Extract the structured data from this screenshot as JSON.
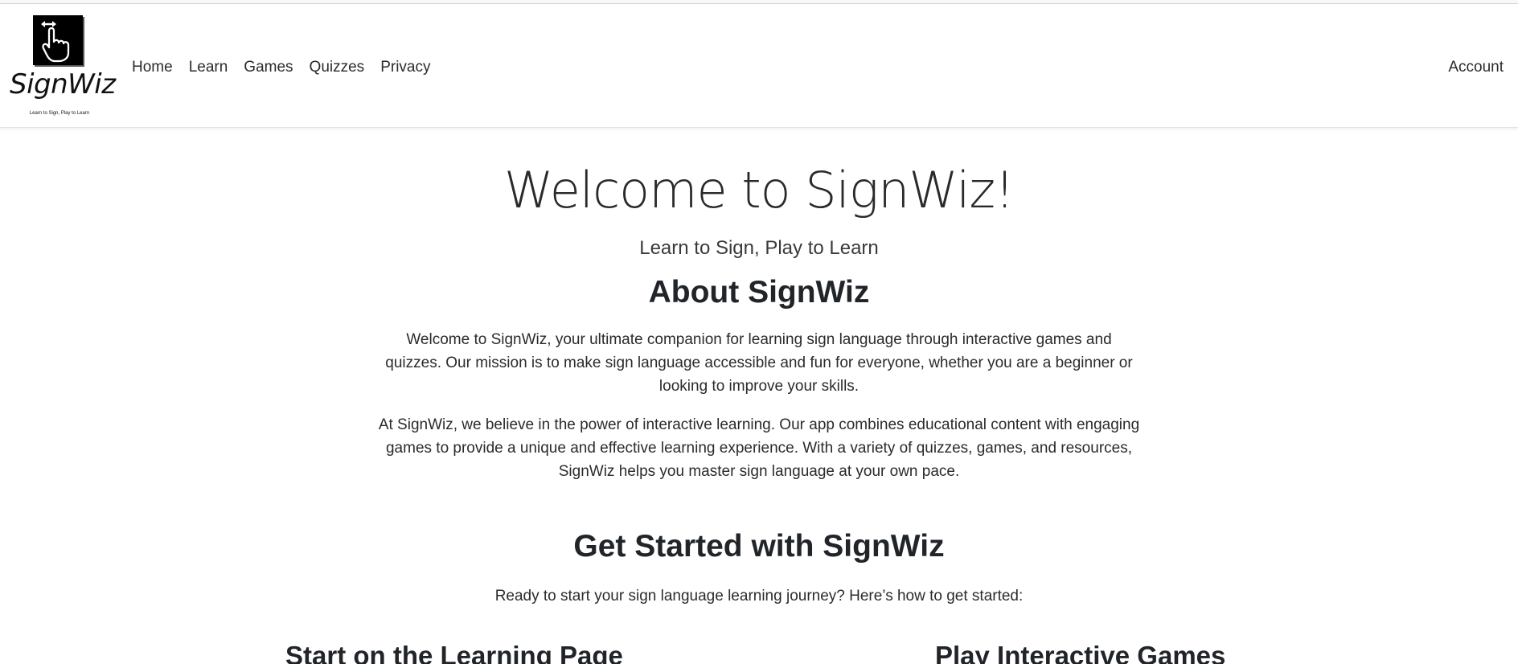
{
  "brand": {
    "name": "SignWiz",
    "tagline": "Learn to Sign, Play to Learn",
    "logo_icon": "hand-pointer-swipe-icon"
  },
  "nav": {
    "items": [
      {
        "label": "Home"
      },
      {
        "label": "Learn"
      },
      {
        "label": "Games"
      },
      {
        "label": "Quizzes"
      },
      {
        "label": "Privacy"
      }
    ],
    "account_label": "Account"
  },
  "hero": {
    "title": "Welcome to SignWiz!",
    "subtitle": "Learn to Sign, Play to Learn"
  },
  "about": {
    "heading": "About SignWiz",
    "paragraphs": [
      "Welcome to SignWiz, your ultimate companion for learning sign language through interactive games and quizzes. Our mission is to make sign language accessible and fun for everyone, whether you are a beginner or looking to improve your skills.",
      "At SignWiz, we believe in the power of interactive learning. Our app combines educational content with engaging games to provide a unique and effective learning experience. With a variety of quizzes, games, and resources, SignWiz helps you master sign language at your own pace."
    ]
  },
  "get_started": {
    "heading": "Get Started with SignWiz",
    "intro": "Ready to start your sign language learning journey? Here’s how to get started:",
    "columns": [
      {
        "title": "Start on the Learning Page"
      },
      {
        "title": "Play Interactive Games"
      }
    ]
  },
  "colors": {
    "text": "#212529",
    "logo_background": "#000000",
    "page_background": "#ffffff"
  }
}
